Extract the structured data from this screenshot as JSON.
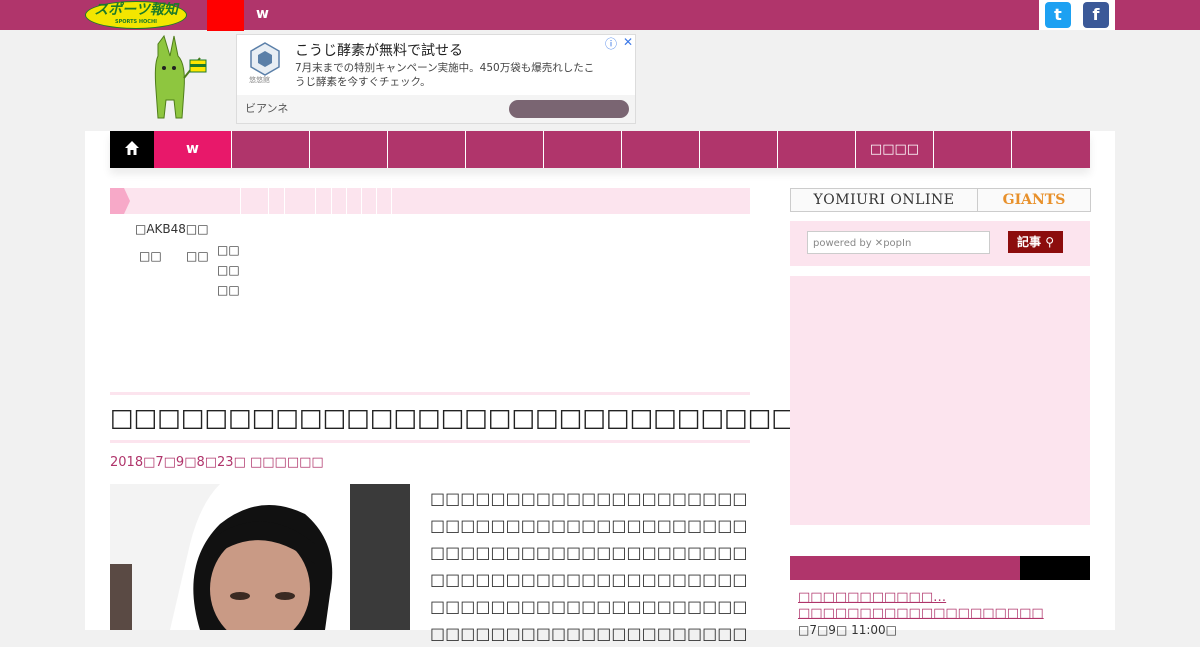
{
  "header": {
    "logo_main": "スポーツ報知",
    "logo_sub": "SPORTS HOCHI",
    "top_nav_label": "w",
    "twitter_glyph": "t",
    "facebook_glyph": "f"
  },
  "ad": {
    "brand": "悠悠館",
    "title": "こうじ酵素が無料で試せる",
    "description": "7月末までの特別キャンペーン実施中。450万袋も爆売れしたこうじ酵素を今すぐチェック。",
    "source": "ビアンネ",
    "info_icon": "ⓘ",
    "close_icon": "✕"
  },
  "nav": {
    "home_icon": "home-icon",
    "active_label": "w",
    "items": [
      "",
      "",
      "",
      "",
      "",
      "",
      "",
      "",
      "□□□□",
      "",
      ""
    ]
  },
  "breadcrumb": {
    "row1": "□AKB48□□",
    "col_a": "□□",
    "col_b": "□□",
    "col_c": [
      "□□",
      "□□",
      "□□"
    ]
  },
  "article": {
    "title": "□□□□□□□□□□□□□□□□□□□□□□□□□□□□□□□□□",
    "date": "2018□7□9□8□23□  □□□□□□",
    "body_lines": [
      "□□□□□□□□□□□□□□□□□□□□□□□□□□□□□□□□□□□□□□□",
      "□□□□□□□□□□□□□□□□□□□□□□□□□□□□□□□□□□□□□□□",
      "□□□□□□□□□□□□□□□□□□□□□□□□□□□□□□□□□□□□□□□",
      "□□□□□□□□□□□□□□□□□□□□□□□□□□□□□□□□□□□□□□□",
      "□□□□□□□□□□□□□□□□□□□□□□□□□□□□□□□□□□□□□□□",
      "□□□□□□□□□□□□□□□□□□□□□□□□□□□□□□□□□□□□□□□"
    ]
  },
  "sidebar": {
    "yomiuri": "YOMIURI ONLINE",
    "giants": "GIANTS",
    "search_placeholder": "powered by ✕popIn",
    "search_button": "記事 ⚲",
    "ranking_item_title": "□□□□□□□□□□□…□□□□□□□□□□□□□□□□□□□□",
    "ranking_item_time": "□7□9□ 11:00□"
  },
  "colors": {
    "brand": "#b0356b",
    "nav_active": "#e8186a",
    "pink_light": "#fce4ee"
  }
}
